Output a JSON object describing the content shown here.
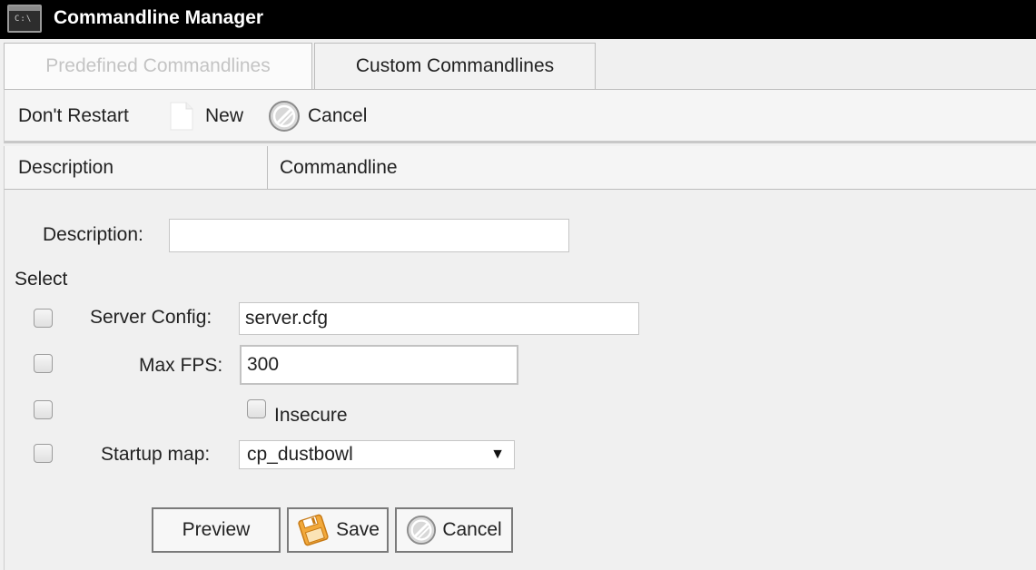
{
  "window": {
    "title": "Commandline Manager",
    "app_icon_text": "C:\\"
  },
  "tabs": [
    {
      "label": "Predefined Commandlines",
      "active": false
    },
    {
      "label": "Custom Commandlines",
      "active": true
    }
  ],
  "toolbar": {
    "dont_restart": "Don't Restart",
    "new": "New",
    "cancel": "Cancel"
  },
  "grid": {
    "columns": [
      "Description",
      "Commandline"
    ]
  },
  "form": {
    "description_label": "Description:",
    "description_value": "",
    "select_label": "Select",
    "server_config_label": "Server Config:",
    "server_config_value": "server.cfg",
    "max_fps_label": "Max FPS:",
    "max_fps_value": "300",
    "insecure_label": "Insecure",
    "startup_map_label": "Startup map:",
    "startup_map_value": "cp_dustbowl"
  },
  "buttons": {
    "preview": "Preview",
    "save": "Save",
    "cancel": "Cancel"
  }
}
